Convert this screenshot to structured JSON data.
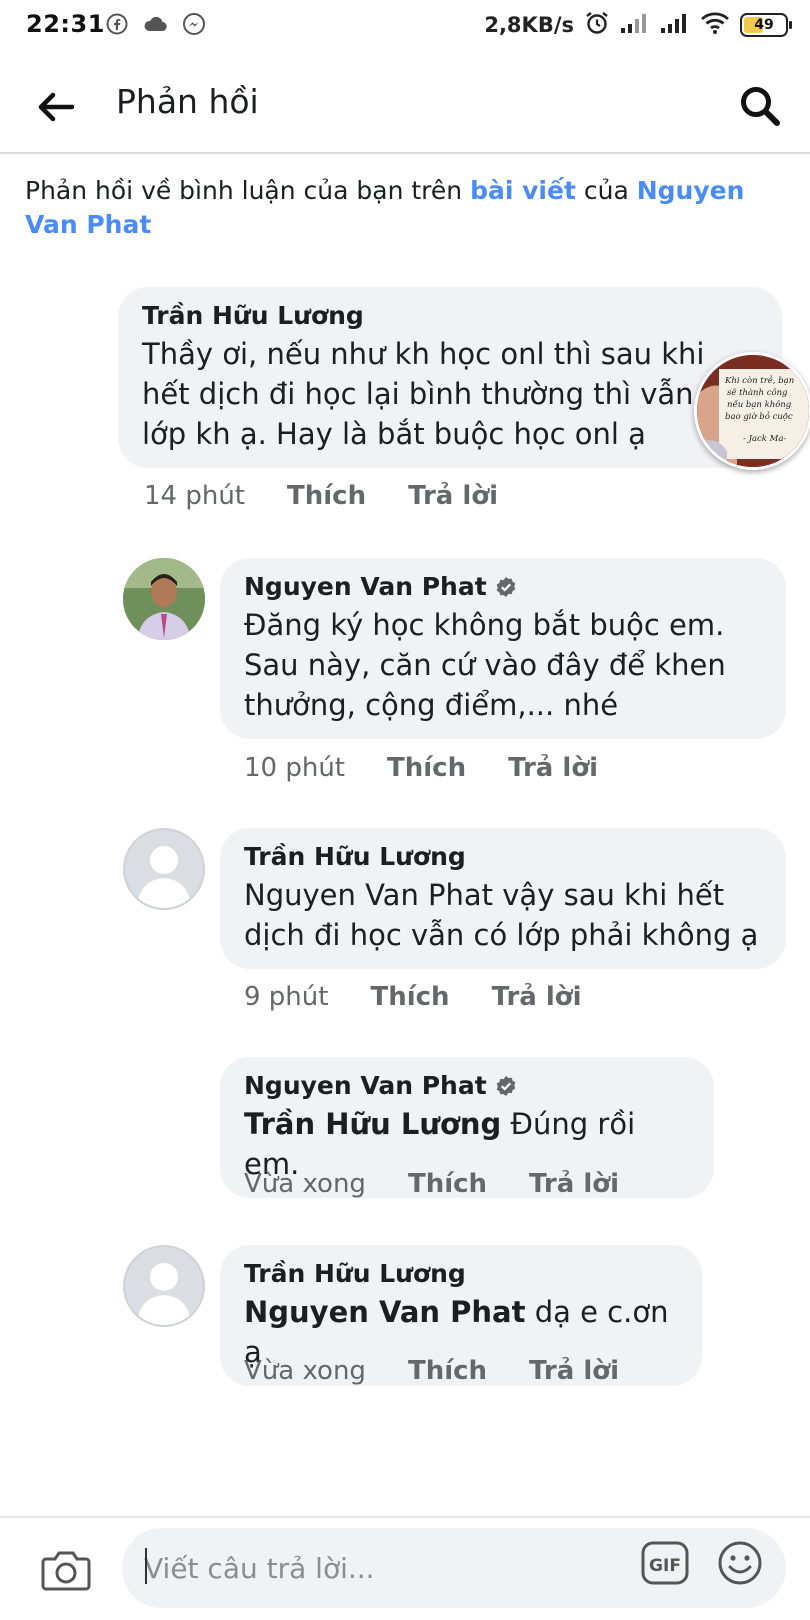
{
  "status_bar": {
    "time": "22:31",
    "left_icons": [
      "facebook-icon",
      "cloud-icon",
      "messenger-icon"
    ],
    "net_speed": "2,8KB/s",
    "right_icons": [
      "alarm-icon",
      "signal-icon",
      "signal-icon",
      "wifi-icon"
    ],
    "battery": "49",
    "battery_level": 0.49
  },
  "header": {
    "title": "Phản hồi",
    "back_icon": "arrow-left-icon",
    "search_icon": "search-icon"
  },
  "context": {
    "prefix": "Phản hồi về bình luận của bạn trên ",
    "post_link": "bài viết",
    "middle": " của ",
    "author_link": "Nguyen Van Phat"
  },
  "comments": [
    {
      "author": "Trần Hữu Lương",
      "text": "Thầy ơi, nếu như kh học onl thì sau khi hết dịch đi học lại bình thường thì vẫn có lớp kh ạ. Hay là bắt buộc học onl ạ",
      "time": "14 phút",
      "like": "Thích",
      "reply": "Trả lời"
    },
    {
      "author": "Nguyen Van Phat",
      "verified": true,
      "text": "Đăng ký học không bắt buộc em. Sau này, căn cứ vào đây để khen thưởng, cộng điểm,... nhé",
      "time": "10 phút",
      "like": "Thích",
      "reply": "Trả lời"
    },
    {
      "author": "Trần Hữu Lương",
      "text": "Nguyen Van Phat vậy sau khi hết dịch đi học vẫn có lớp phải không ạ",
      "time": "9 phút",
      "like": "Thích",
      "reply": "Trả lời"
    },
    {
      "author": "Nguyen Van Phat",
      "verified": true,
      "mention": "Trần Hữu Lương",
      "text": " Đúng rồi em.",
      "time": "Vừa xong",
      "like": "Thích",
      "reply": "Trả lời"
    },
    {
      "author": "Trần Hữu Lương",
      "mention": "Nguyen Van Phat",
      "text": " dạ e c.ơn ạ",
      "time": "Vừa xong",
      "like": "Thích",
      "reply": "Trả lời"
    }
  ],
  "chat_head": {
    "lines": [
      "Khi còn trẻ, bạn",
      "sẽ thành công",
      "nếu bạn không",
      "bao giờ bỏ cuộc",
      "- Jack Ma-"
    ]
  },
  "composer": {
    "placeholder": "Viết câu trả lời...",
    "camera_icon": "camera-icon",
    "gif_label": "GIF",
    "emoji_icon": "smiley-icon"
  }
}
